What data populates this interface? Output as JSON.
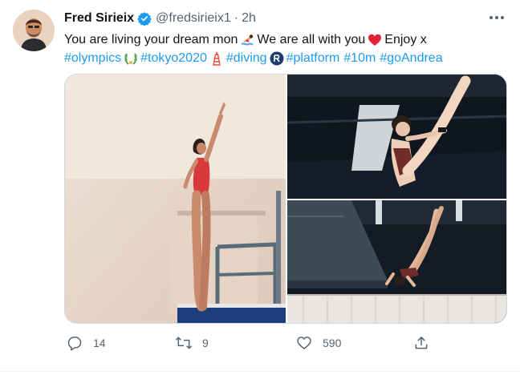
{
  "author": {
    "name": "Fred Sirieix",
    "handle": "@fredsirieix1",
    "separator": "·",
    "time": "2h",
    "verified": true,
    "avatar_icon": "profile-photo"
  },
  "tweet": {
    "line1": {
      "part1": "You are living your dream mon",
      "part2": "We are all with you",
      "part3": "Enjoy x"
    },
    "hashtags": [
      "#olympics",
      "#tokyo2020",
      "#diving",
      "#platform",
      "#10m",
      "#goAndrea"
    ],
    "emoji": [
      "swimmer-emoji",
      "red-heart-emoji",
      "laurel-emoji",
      "tokyo-tower-emoji",
      "olympic-logo-emoji"
    ]
  },
  "media": {
    "photos": [
      "diver-on-platform-photo",
      "diver-mid-air-tuck-photo",
      "diver-in-flight-photo"
    ]
  },
  "actions": {
    "reply_count": "14",
    "retweet_count": "9",
    "like_count": "590"
  },
  "colors": {
    "link": "#1d9bf0",
    "text": "#0f1419",
    "muted": "#536471",
    "verified": "#1d9bf0"
  }
}
